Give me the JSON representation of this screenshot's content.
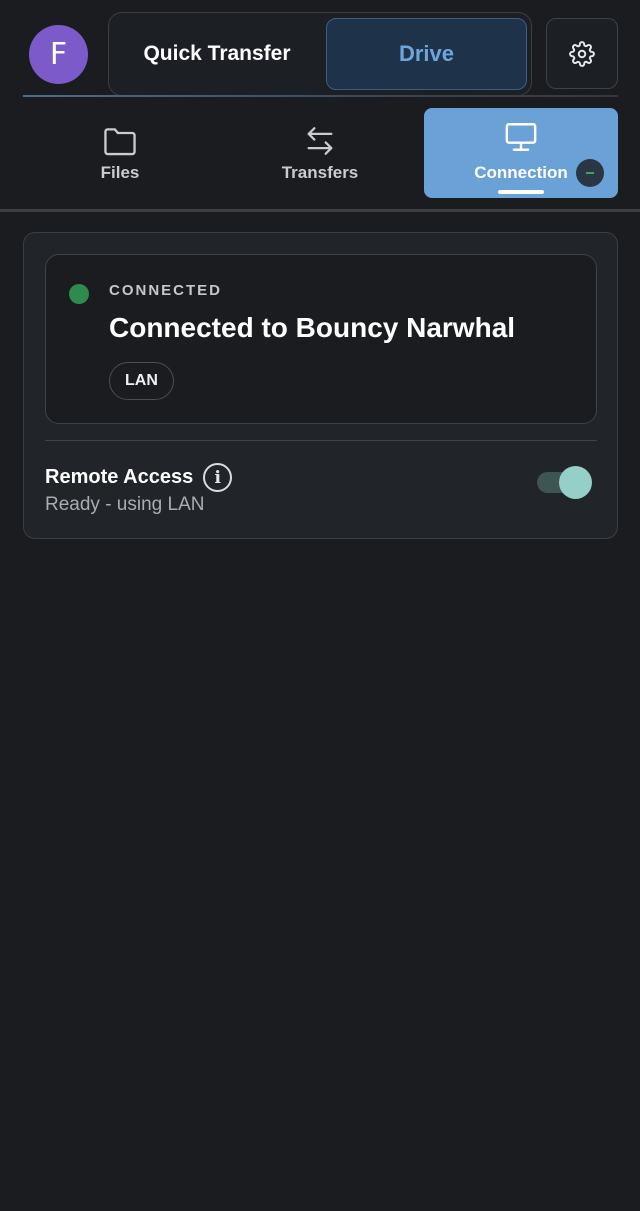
{
  "header": {
    "avatar_letter": "F",
    "mode_switch": {
      "quick_transfer": "Quick Transfer",
      "drive": "Drive"
    },
    "settings_icon": "gear-icon"
  },
  "tabs": [
    {
      "label": "Files",
      "icon": "folder-icon"
    },
    {
      "label": "Transfers",
      "icon": "arrows-swap-icon"
    },
    {
      "label": "Connection",
      "icon": "monitor-icon",
      "active": true
    }
  ],
  "connection": {
    "status": "CONNECTED",
    "title": "Connected to Bouncy Narwhal",
    "chip": "LAN"
  },
  "remote_access": {
    "title": "Remote Access",
    "info_symbol": "i",
    "subtitle": "Ready - using LAN",
    "enabled": true
  },
  "colors": {
    "accent": "#6aa2d8",
    "avatar": "#7c5ac9",
    "status_connected": "#2f8a4e",
    "toggle_knob": "#95d0c8"
  }
}
